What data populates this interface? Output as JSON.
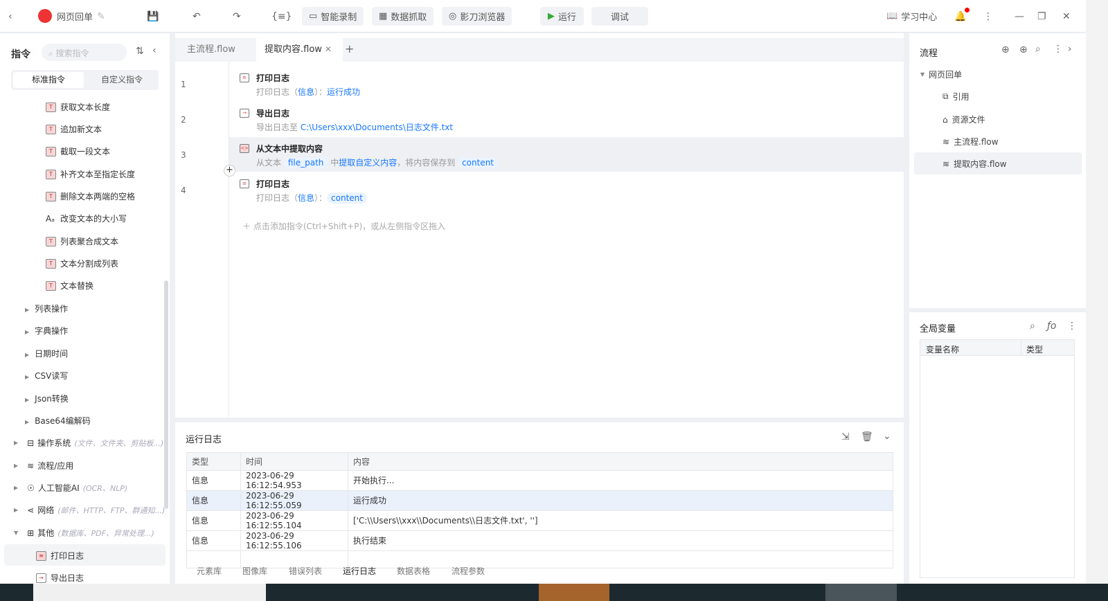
{
  "toolbar": {
    "project": "网页回单",
    "record": "智能录制",
    "scrape": "数据抓取",
    "browser": "影刀浏览器",
    "run": "运行",
    "debug": "调试",
    "learn": "学习中心"
  },
  "left": {
    "title": "指令",
    "search_placeholder": "搜索指令",
    "tabs": [
      "标准指令",
      "自定义指令"
    ],
    "commands": [
      "获取文本长度",
      "追加新文本",
      "截取一段文本",
      "补齐文本至指定长度",
      "删除文本两端的空格",
      "改变文本的大小写",
      "列表聚合成文本",
      "文本分割成列表",
      "文本替换"
    ],
    "groups": [
      "列表操作",
      "字典操作",
      "日期时间",
      "CSV读写",
      "Json转换",
      "Base64编解码"
    ],
    "categories": [
      {
        "label": "操作系统",
        "hint": "(文件、文件夹、剪贴板...)"
      },
      {
        "label": "流程/应用",
        "hint": ""
      },
      {
        "label": "人工智能AI",
        "hint": "(OCR、NLP)"
      },
      {
        "label": "网络",
        "hint": "(邮件、HTTP、FTP、群通知...)"
      },
      {
        "label": "其他",
        "hint": "(数据库、PDF、异常处理...)"
      }
    ],
    "sub": [
      "打印日志",
      "导出日志"
    ]
  },
  "editor": {
    "tabs": [
      "主流程.flow",
      "提取内容.flow"
    ],
    "steps": [
      {
        "n": "1",
        "title": "打印日志",
        "pre": "打印日志（",
        "a": "信息",
        "mid": "）：",
        "b": "运行成功"
      },
      {
        "n": "2",
        "title": "导出日志",
        "pre": "导出日志至 ",
        "b": "C:\\Users\\xxx\\Documents\\日志文件.txt"
      },
      {
        "n": "3",
        "title": "从文本中提取内容",
        "pre": "从文本 ",
        "a": "file_path",
        "mid": " 中",
        "c": "提取自定义内容",
        "mid2": "，将内容保存到 ",
        "b": "content"
      },
      {
        "n": "4",
        "title": "打印日志",
        "pre": "打印日志（",
        "a": "信息",
        "mid": "）：",
        "b": "content"
      }
    ],
    "add_hint": "点击添加指令(Ctrl+Shift+P)，或从左侧指令区拖入"
  },
  "log": {
    "title": "运行日志",
    "headers": [
      "类型",
      "时间",
      "内容"
    ],
    "rows": [
      [
        "信息",
        "2023-06-29 16:12:54.953",
        "开始执行..."
      ],
      [
        "信息",
        "2023-06-29 16:12:55.059",
        "运行成功"
      ],
      [
        "信息",
        "2023-06-29 16:12:55.104",
        "['C:\\\\Users\\\\xxx\\\\Documents\\\\日志文件.txt', '']"
      ],
      [
        "信息",
        "2023-06-29 16:12:55.106",
        "执行结束"
      ]
    ],
    "tabs": [
      "元素库",
      "图像库",
      "错误列表",
      "运行日志",
      "数据表格",
      "流程参数"
    ]
  },
  "right": {
    "title": "流程",
    "root": "网页回单",
    "items": [
      "引用",
      "资源文件",
      "主流程.flow",
      "提取内容.flow"
    ],
    "vars_title": "全局变量",
    "var_headers": [
      "变量名称",
      "类型"
    ]
  }
}
